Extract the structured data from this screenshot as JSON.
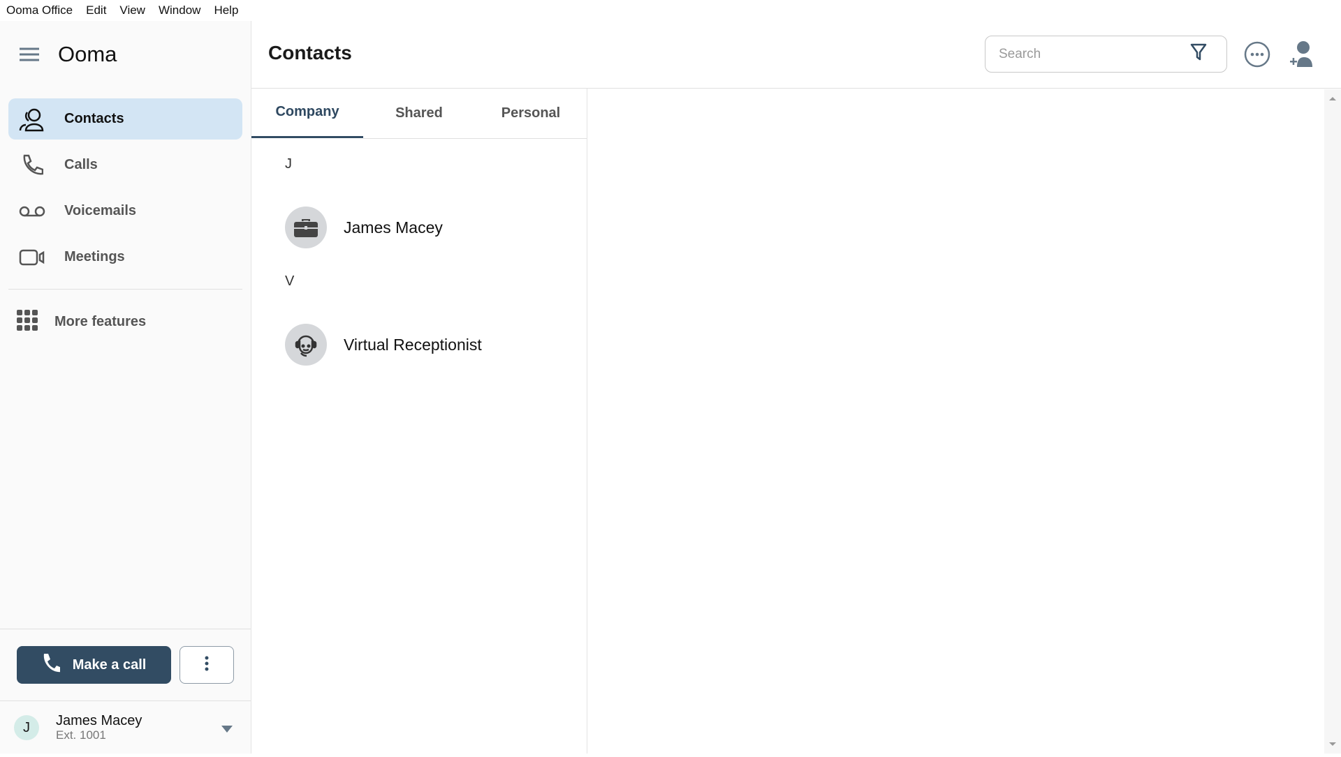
{
  "menubar": {
    "items": [
      "Ooma Office",
      "Edit",
      "View",
      "Window",
      "Help"
    ]
  },
  "sidebar": {
    "logo": "Ooma",
    "items": [
      {
        "label": "Contacts",
        "icon": "contacts-icon",
        "active": true
      },
      {
        "label": "Calls",
        "icon": "phone-icon"
      },
      {
        "label": "Voicemails",
        "icon": "voicemail-icon"
      },
      {
        "label": "Meetings",
        "icon": "video-icon"
      }
    ],
    "more_features": "More features",
    "make_call": "Make a call",
    "user": {
      "initial": "J",
      "name": "James Macey",
      "ext": "Ext. 1001"
    }
  },
  "header": {
    "title": "Contacts",
    "search_placeholder": "Search"
  },
  "tabs": [
    {
      "label": "Company",
      "active": true
    },
    {
      "label": "Shared"
    },
    {
      "label": "Personal"
    }
  ],
  "contacts": [
    {
      "letter": "J",
      "name": "James Macey",
      "icon": "briefcase-icon"
    },
    {
      "letter": "V",
      "name": "Virtual Receptionist",
      "icon": "headset-icon"
    }
  ],
  "colors": {
    "accent": "#324c63",
    "active_bg": "#d3e5f4",
    "avatar_bg": "#d4ece8"
  }
}
